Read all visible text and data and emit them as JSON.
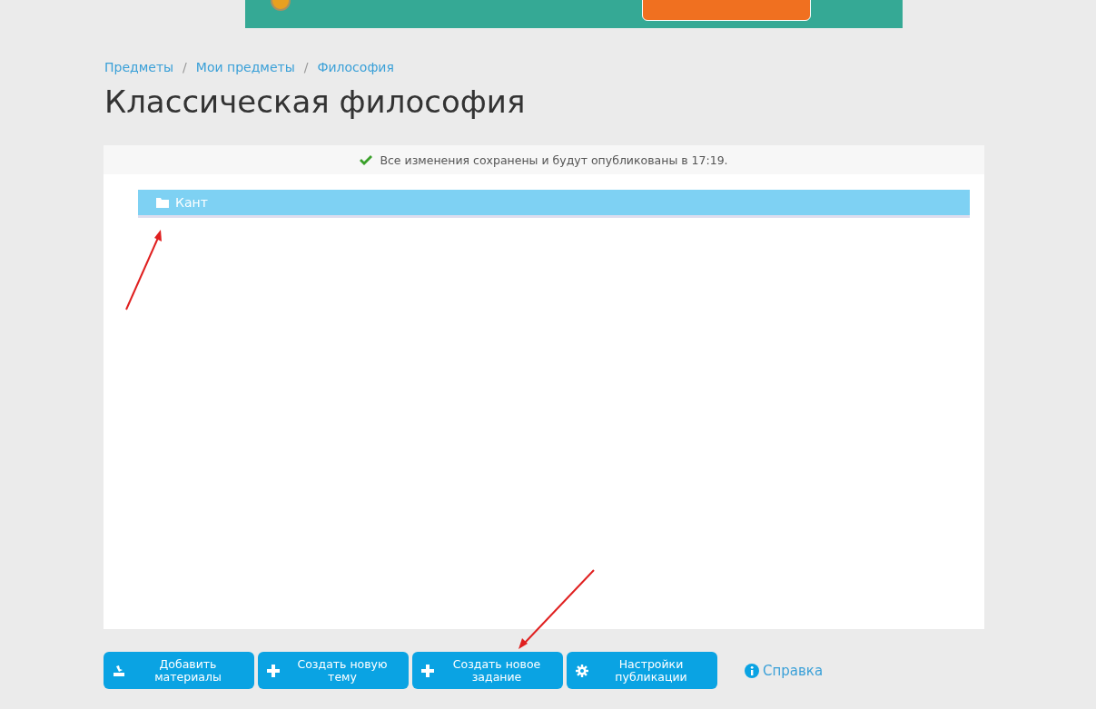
{
  "breadcrumbs": [
    {
      "label": "Предметы",
      "kind": "link"
    },
    {
      "label": "/",
      "kind": "separator"
    },
    {
      "label": "Мои предметы",
      "kind": "link"
    },
    {
      "label": "/",
      "kind": "separator"
    },
    {
      "label": "Философия",
      "kind": "link"
    }
  ],
  "title": "Классическая философия",
  "status": {
    "message": "Все изменения сохранены и будут опубликованы в 17:19."
  },
  "items": [
    {
      "label": "Кант",
      "kind": "folder"
    }
  ],
  "buttons": [
    {
      "label": "Добавить материалы"
    },
    {
      "label": "Создать новую тему"
    },
    {
      "label": "Создать новое задание"
    },
    {
      "label": "Настройки публикации"
    }
  ],
  "help": {
    "label": "Справка"
  }
}
